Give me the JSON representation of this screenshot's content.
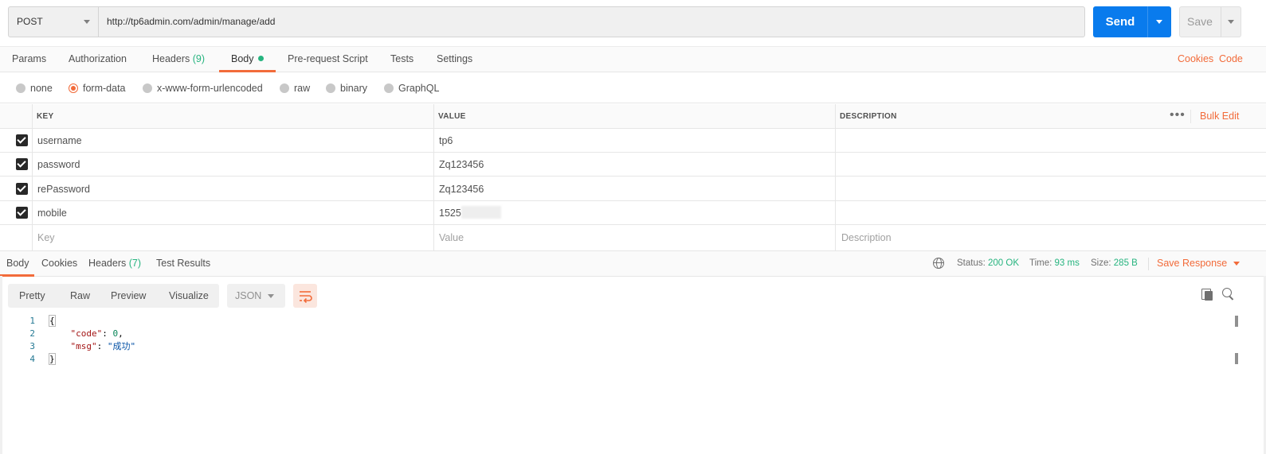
{
  "request": {
    "method": "POST",
    "url": "http://tp6admin.com/admin/manage/add",
    "send_label": "Send",
    "save_label": "Save"
  },
  "request_tabs": [
    {
      "label": "Params"
    },
    {
      "label": "Authorization"
    },
    {
      "label": "Headers",
      "count": "(9)"
    },
    {
      "label": "Body"
    },
    {
      "label": "Pre-request Script"
    },
    {
      "label": "Tests"
    },
    {
      "label": "Settings"
    }
  ],
  "links": {
    "cookies": "Cookies",
    "code": "Code"
  },
  "body_types": [
    {
      "label": "none"
    },
    {
      "label": "form-data",
      "selected": true
    },
    {
      "label": "x-www-form-urlencoded"
    },
    {
      "label": "raw"
    },
    {
      "label": "binary"
    },
    {
      "label": "GraphQL"
    }
  ],
  "table": {
    "headers": {
      "key": "KEY",
      "value": "VALUE",
      "description": "DESCRIPTION"
    },
    "bulk_edit": "Bulk Edit",
    "more": "•••",
    "rows": [
      {
        "key": "username",
        "value": "tp6",
        "checked": true
      },
      {
        "key": "password",
        "value": "Zq123456",
        "checked": true
      },
      {
        "key": "rePassword",
        "value": "Zq123456",
        "checked": true
      },
      {
        "key": "mobile",
        "value": "1525",
        "checked": true
      }
    ],
    "placeholders": {
      "key": "Key",
      "value": "Value",
      "description": "Description"
    }
  },
  "response": {
    "tabs": [
      {
        "label": "Body"
      },
      {
        "label": "Cookies"
      },
      {
        "label": "Headers",
        "count": "(7)"
      },
      {
        "label": "Test Results"
      }
    ],
    "status_label": "Status:",
    "status_value": "200 OK",
    "time_label": "Time:",
    "time_value": "93 ms",
    "size_label": "Size:",
    "size_value": "285 B",
    "save_response": "Save Response",
    "views": [
      "Pretty",
      "Raw",
      "Preview",
      "Visualize"
    ],
    "format": "JSON"
  },
  "code": {
    "line_numbers": [
      "1",
      "2",
      "3",
      "4"
    ],
    "open": "{",
    "code_key": "\"code\"",
    "code_value": "0",
    "msg_key": "\"msg\"",
    "msg_value": "\"成功\"",
    "close": "}"
  },
  "colors": {
    "accent": "#f26b3a",
    "send": "#097bed",
    "success": "#26b47f"
  }
}
